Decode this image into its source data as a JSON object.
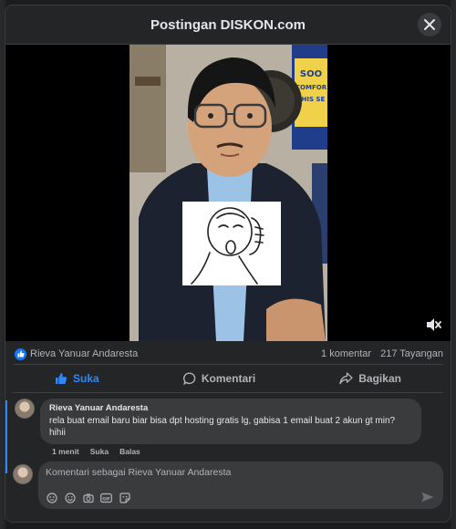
{
  "modal": {
    "title": "Postingan DISKON.com"
  },
  "icons": {
    "close": "close-icon",
    "mute": "speaker-muted-icon",
    "like_badge": "thumbs-up-icon",
    "like": "thumbs-up-icon",
    "comment": "speech-bubble-icon",
    "share": "share-arrow-icon",
    "send": "send-icon",
    "avatar": "gif-icon",
    "emoji": "smiley-icon",
    "camera": "camera-icon",
    "gif": "gif-icon",
    "sticker": "sticker-icon"
  },
  "colors": {
    "accent": "#2d88ff",
    "like_badge": "#1877f2"
  },
  "post": {
    "liker": "Rieva Yanuar Andaresta",
    "comments_count": "1 komentar",
    "views": "217 Tayangan",
    "sign_text": "SOO COMFOR THIS SE"
  },
  "actions": {
    "like": "Suka",
    "comment": "Komentari",
    "share": "Bagikan"
  },
  "comment": {
    "author": "Rieva Yanuar Andaresta",
    "text": "rela buat email baru biar bisa dpt hosting gratis lg, gabisa 1 email buat 2 akun gt min? hihii",
    "time": "1 menit",
    "like": "Suka",
    "reply": "Balas"
  },
  "composer": {
    "placeholder": "Komentari sebagai Rieva Yanuar Andaresta"
  }
}
